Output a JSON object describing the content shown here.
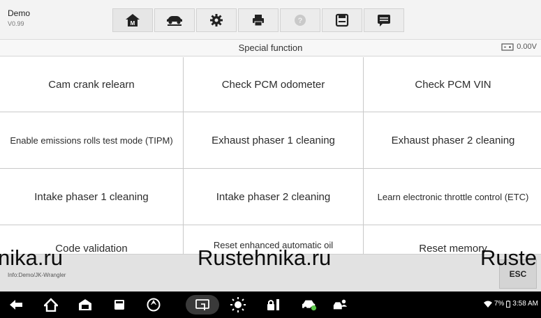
{
  "app": {
    "title": "Demo",
    "version": "V0.99"
  },
  "toolbar": {
    "buttons": [
      {
        "icon": "home-icon",
        "active": true
      },
      {
        "icon": "vehicle-lift-icon"
      },
      {
        "icon": "settings-gear-icon"
      },
      {
        "icon": "printer-icon"
      },
      {
        "icon": "help-icon",
        "disabled": true
      },
      {
        "icon": "save-icon"
      },
      {
        "icon": "message-icon"
      }
    ]
  },
  "subheader": {
    "title": "Special function",
    "voltage": "0.00V"
  },
  "functions": [
    "Cam crank relearn",
    "Check PCM odometer",
    "Check PCM VIN",
    "Enable emissions rolls test mode (TIPM)",
    "Exhaust phaser 1 cleaning",
    "Exhaust phaser 2 cleaning",
    "Intake phaser 1 cleaning",
    "Intake phaser 2 cleaning",
    "Learn electronic throttle control (ETC)",
    "Code validation",
    "Reset enhanced automatic oil",
    "Reset memory"
  ],
  "info": {
    "path": "Info:Demo/JK-Wrangler",
    "esc_label": "ESC"
  },
  "watermark": {
    "left": "nika.ru",
    "center": "Rustehnika.ru",
    "right": "Ruste"
  },
  "statusbar": {
    "battery": "7%",
    "time": "3:58 AM"
  },
  "colors": {
    "accent_green": "#5cc94a",
    "bar_black": "#000000",
    "header_bg": "#f3f3f3"
  }
}
